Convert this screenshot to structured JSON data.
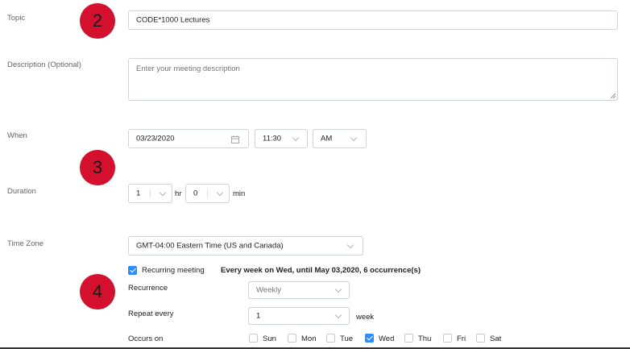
{
  "steps": {
    "s2": "2",
    "s3": "3",
    "s4": "4"
  },
  "topic": {
    "label": "Topic",
    "value": "CODE*1000 Lectures"
  },
  "description": {
    "label": "Description (Optional)",
    "placeholder": "Enter your meeting description"
  },
  "when": {
    "label": "When",
    "date": "03/23/2020",
    "time": "11:30",
    "ampm": "AM"
  },
  "duration": {
    "label": "Duration",
    "hours": "1",
    "hr_unit": "hr",
    "minutes": "0",
    "min_unit": "min"
  },
  "timezone": {
    "label": "Time Zone",
    "value": "GMT-04:00 Eastern Time (US and Canada)"
  },
  "recurring": {
    "checkbox_label": "Recurring meeting",
    "summary": "Every week on Wed, until May 03,2020, 6 occurrence(s)",
    "recurrence_label": "Recurrence",
    "recurrence_value": "Weekly",
    "repeat_label": "Repeat every",
    "repeat_value": "1",
    "repeat_unit": "week",
    "occurs_label": "Occurs on",
    "days": [
      {
        "label": "Sun",
        "checked": false
      },
      {
        "label": "Mon",
        "checked": false
      },
      {
        "label": "Tue",
        "checked": false
      },
      {
        "label": "Wed",
        "checked": true
      },
      {
        "label": "Thu",
        "checked": false
      },
      {
        "label": "Fri",
        "checked": false
      },
      {
        "label": "Sat",
        "checked": false
      }
    ]
  },
  "colors": {
    "accent": "#2d8cff",
    "step_badge": "#d3102d"
  }
}
